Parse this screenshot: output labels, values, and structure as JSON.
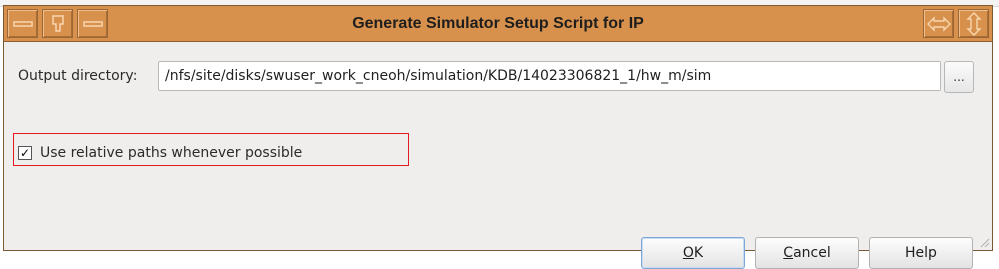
{
  "dialog": {
    "title": "Generate Simulator Setup Script for IP"
  },
  "titlebar": {
    "left_buttons": [
      "minimize-icon",
      "pin-icon",
      "menu-bar-icon"
    ],
    "right_buttons": [
      "resize-horizontal-icon",
      "resize-vertical-icon"
    ],
    "color": "#d8914c"
  },
  "output": {
    "label": "Output directory:",
    "value": "/nfs/site/disks/swuser_work_cneoh/simulation/KDB/14023306821_1/hw_m/sim",
    "browse_label": "..."
  },
  "relative_paths": {
    "label": "Use relative paths whenever possible",
    "checked": true,
    "check_mark": "✓",
    "highlight_color": "#e21b23"
  },
  "buttons": {
    "ok": {
      "mnemonic": "O",
      "rest": "K"
    },
    "cancel": {
      "mnemonic": "C",
      "rest": "ancel"
    },
    "help": "Help"
  }
}
